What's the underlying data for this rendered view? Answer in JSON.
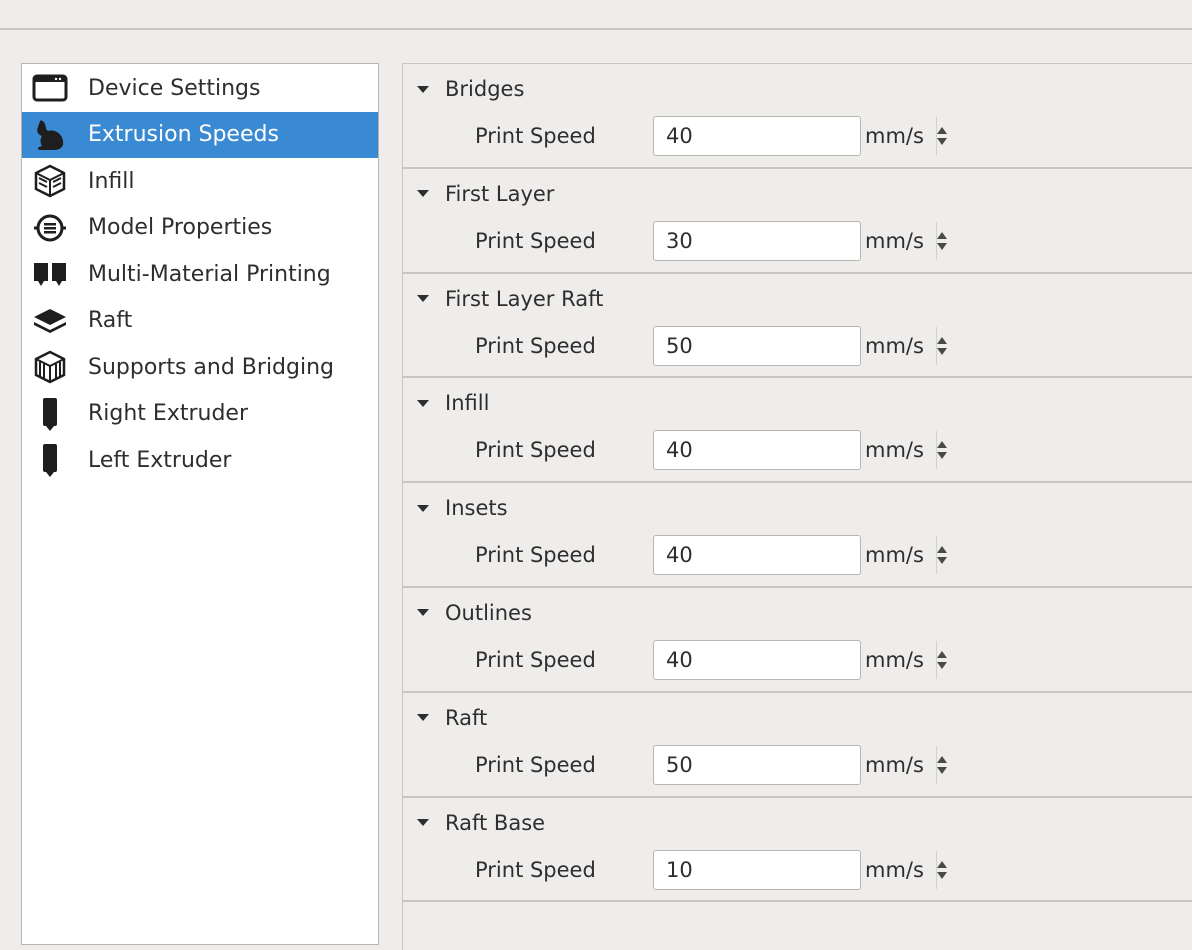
{
  "sidebar": {
    "items": [
      {
        "label": "Device Settings",
        "icon": "window-icon",
        "selected": false
      },
      {
        "label": "Extrusion Speeds",
        "icon": "rabbit-icon",
        "selected": true
      },
      {
        "label": "Infill",
        "icon": "cube-infill-icon",
        "selected": false
      },
      {
        "label": "Model Properties",
        "icon": "model-properties-icon",
        "selected": false
      },
      {
        "label": "Multi-Material Printing",
        "icon": "dual-extruder-icon",
        "selected": false
      },
      {
        "label": "Raft",
        "icon": "layers-icon",
        "selected": false
      },
      {
        "label": "Supports and Bridging",
        "icon": "supports-icon",
        "selected": false
      },
      {
        "label": "Right Extruder",
        "icon": "extruder-icon",
        "selected": false
      },
      {
        "label": "Left Extruder",
        "icon": "extruder-icon",
        "selected": false
      }
    ]
  },
  "sections": [
    {
      "title": "Bridges",
      "field_label": "Print Speed",
      "value": "40",
      "unit": "mm/s"
    },
    {
      "title": "First Layer",
      "field_label": "Print Speed",
      "value": "30",
      "unit": "mm/s"
    },
    {
      "title": "First Layer Raft",
      "field_label": "Print Speed",
      "value": "50",
      "unit": "mm/s"
    },
    {
      "title": "Infill",
      "field_label": "Print Speed",
      "value": "40",
      "unit": "mm/s"
    },
    {
      "title": "Insets",
      "field_label": "Print Speed",
      "value": "40",
      "unit": "mm/s"
    },
    {
      "title": "Outlines",
      "field_label": "Print Speed",
      "value": "40",
      "unit": "mm/s"
    },
    {
      "title": "Raft",
      "field_label": "Print Speed",
      "value": "50",
      "unit": "mm/s"
    },
    {
      "title": "Raft Base",
      "field_label": "Print Speed",
      "value": "10",
      "unit": "mm/s"
    }
  ],
  "colors": {
    "selection": "#3a8ad3",
    "panel_bg": "#efedeb",
    "list_bg": "#ffffff"
  }
}
